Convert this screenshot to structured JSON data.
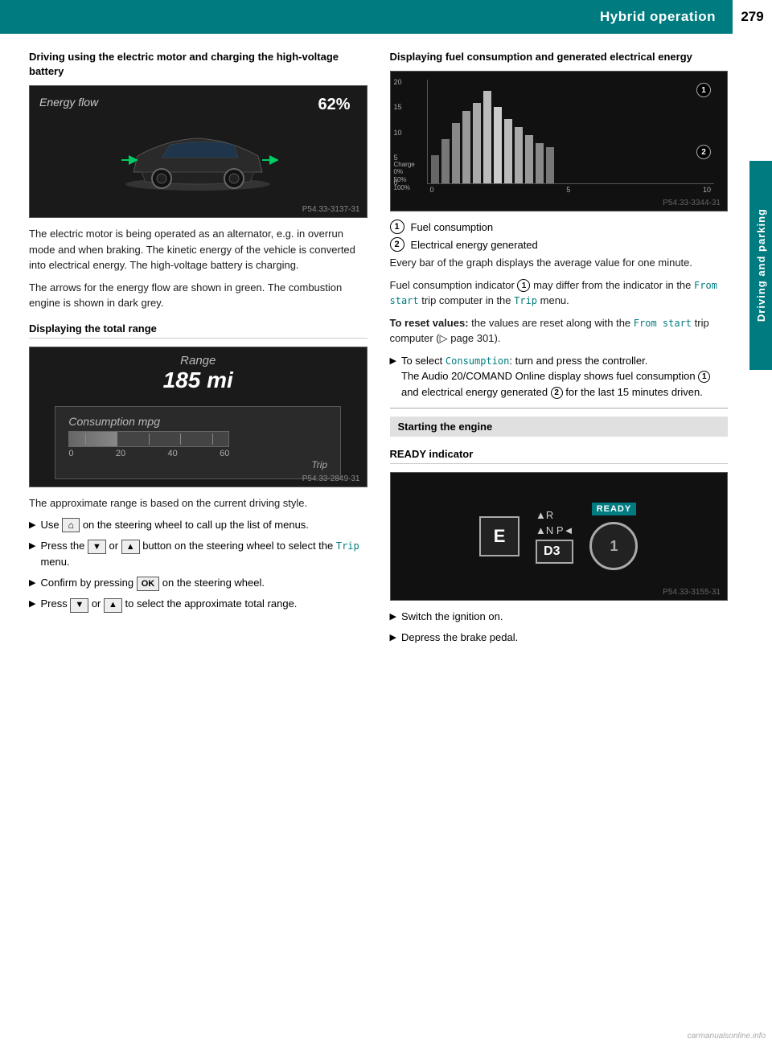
{
  "header": {
    "section_title": "Hybrid operation",
    "page_number": "279",
    "tab_label": "Driving and parking"
  },
  "left_col": {
    "section1": {
      "title": "Driving using the electric motor and charging the high-voltage battery",
      "image_ref": "P54.33-3137-31",
      "energy_flow_label": "Energy flow",
      "energy_percent": "62%",
      "desc1": "The electric motor is being operated as an alternator, e.g. in overrun mode and when braking. The kinetic energy of the vehicle is converted into electrical energy. The high-voltage battery is charging.",
      "desc2": "The arrows for the energy flow are shown in green. The combustion engine is shown in dark grey."
    },
    "section2": {
      "title": "Displaying the total range",
      "image_ref": "P54.33-2849-31",
      "range_label": "Range",
      "range_value": "185 mi",
      "consumption_label": "Consumption mpg",
      "gauge_marks": [
        "0",
        "20",
        "40",
        "60"
      ],
      "trip_label": "Trip",
      "desc": "The approximate range is based on the current driving style.",
      "bullets": [
        {
          "text": "Use",
          "btn": "home",
          "text2": "on the steering wheel to call up the list of menus."
        },
        {
          "text": "Press the",
          "btn_down": "▼",
          "text_or": "or",
          "btn_up": "▲",
          "text2": "button on the steering wheel to select the",
          "mono": "Trip",
          "text3": "menu."
        },
        {
          "text": "Confirm by pressing",
          "btn": "OK",
          "text2": "on the steering wheel."
        },
        {
          "text": "Press",
          "btn_down": "▼",
          "text_or": "or",
          "btn_up": "▲",
          "text2": "to select the approximate total range."
        }
      ]
    }
  },
  "right_col": {
    "section1": {
      "title": "Displaying fuel consumption and generated electrical energy",
      "image_ref": "P54.33-3344-31",
      "callout1": "Fuel consumption",
      "callout2": "Electrical energy generated",
      "desc1": "Every bar of the graph displays the average value for one minute.",
      "desc2": "Fuel consumption indicator",
      "callout_ref1": "1",
      "desc2b": "may differ from the indicator in the",
      "mono1": "From start",
      "desc2c": "trip computer in the",
      "mono2": "Trip",
      "desc2d": "menu.",
      "reset_bold": "To reset values:",
      "reset_text": "the values are reset along with the",
      "mono3": "From start",
      "reset_text2": "trip computer (▷ page 301).",
      "bullet1_text": "To select",
      "bullet1_mono": "Consumption",
      "bullet1_text2": ": turn and press the controller.",
      "bullet1_sub": "The Audio 20/COMAND Online display shows fuel consumption",
      "bullet1_sub2": "and electrical energy generated",
      "bullet1_sub3": "for the last 15 minutes driven."
    },
    "section2": {
      "header": "Starting the engine",
      "subsection": "READY indicator",
      "image_ref": "P54.33-3155-31",
      "ready_label": "READY",
      "e_label": "E",
      "r_label": "▲R",
      "np_label": "▲N P◄",
      "d3_label": "D3",
      "callout1": "1",
      "bullets": [
        "Switch the ignition on.",
        "Depress the brake pedal."
      ]
    }
  },
  "watermark": "carmanualsonline.info"
}
